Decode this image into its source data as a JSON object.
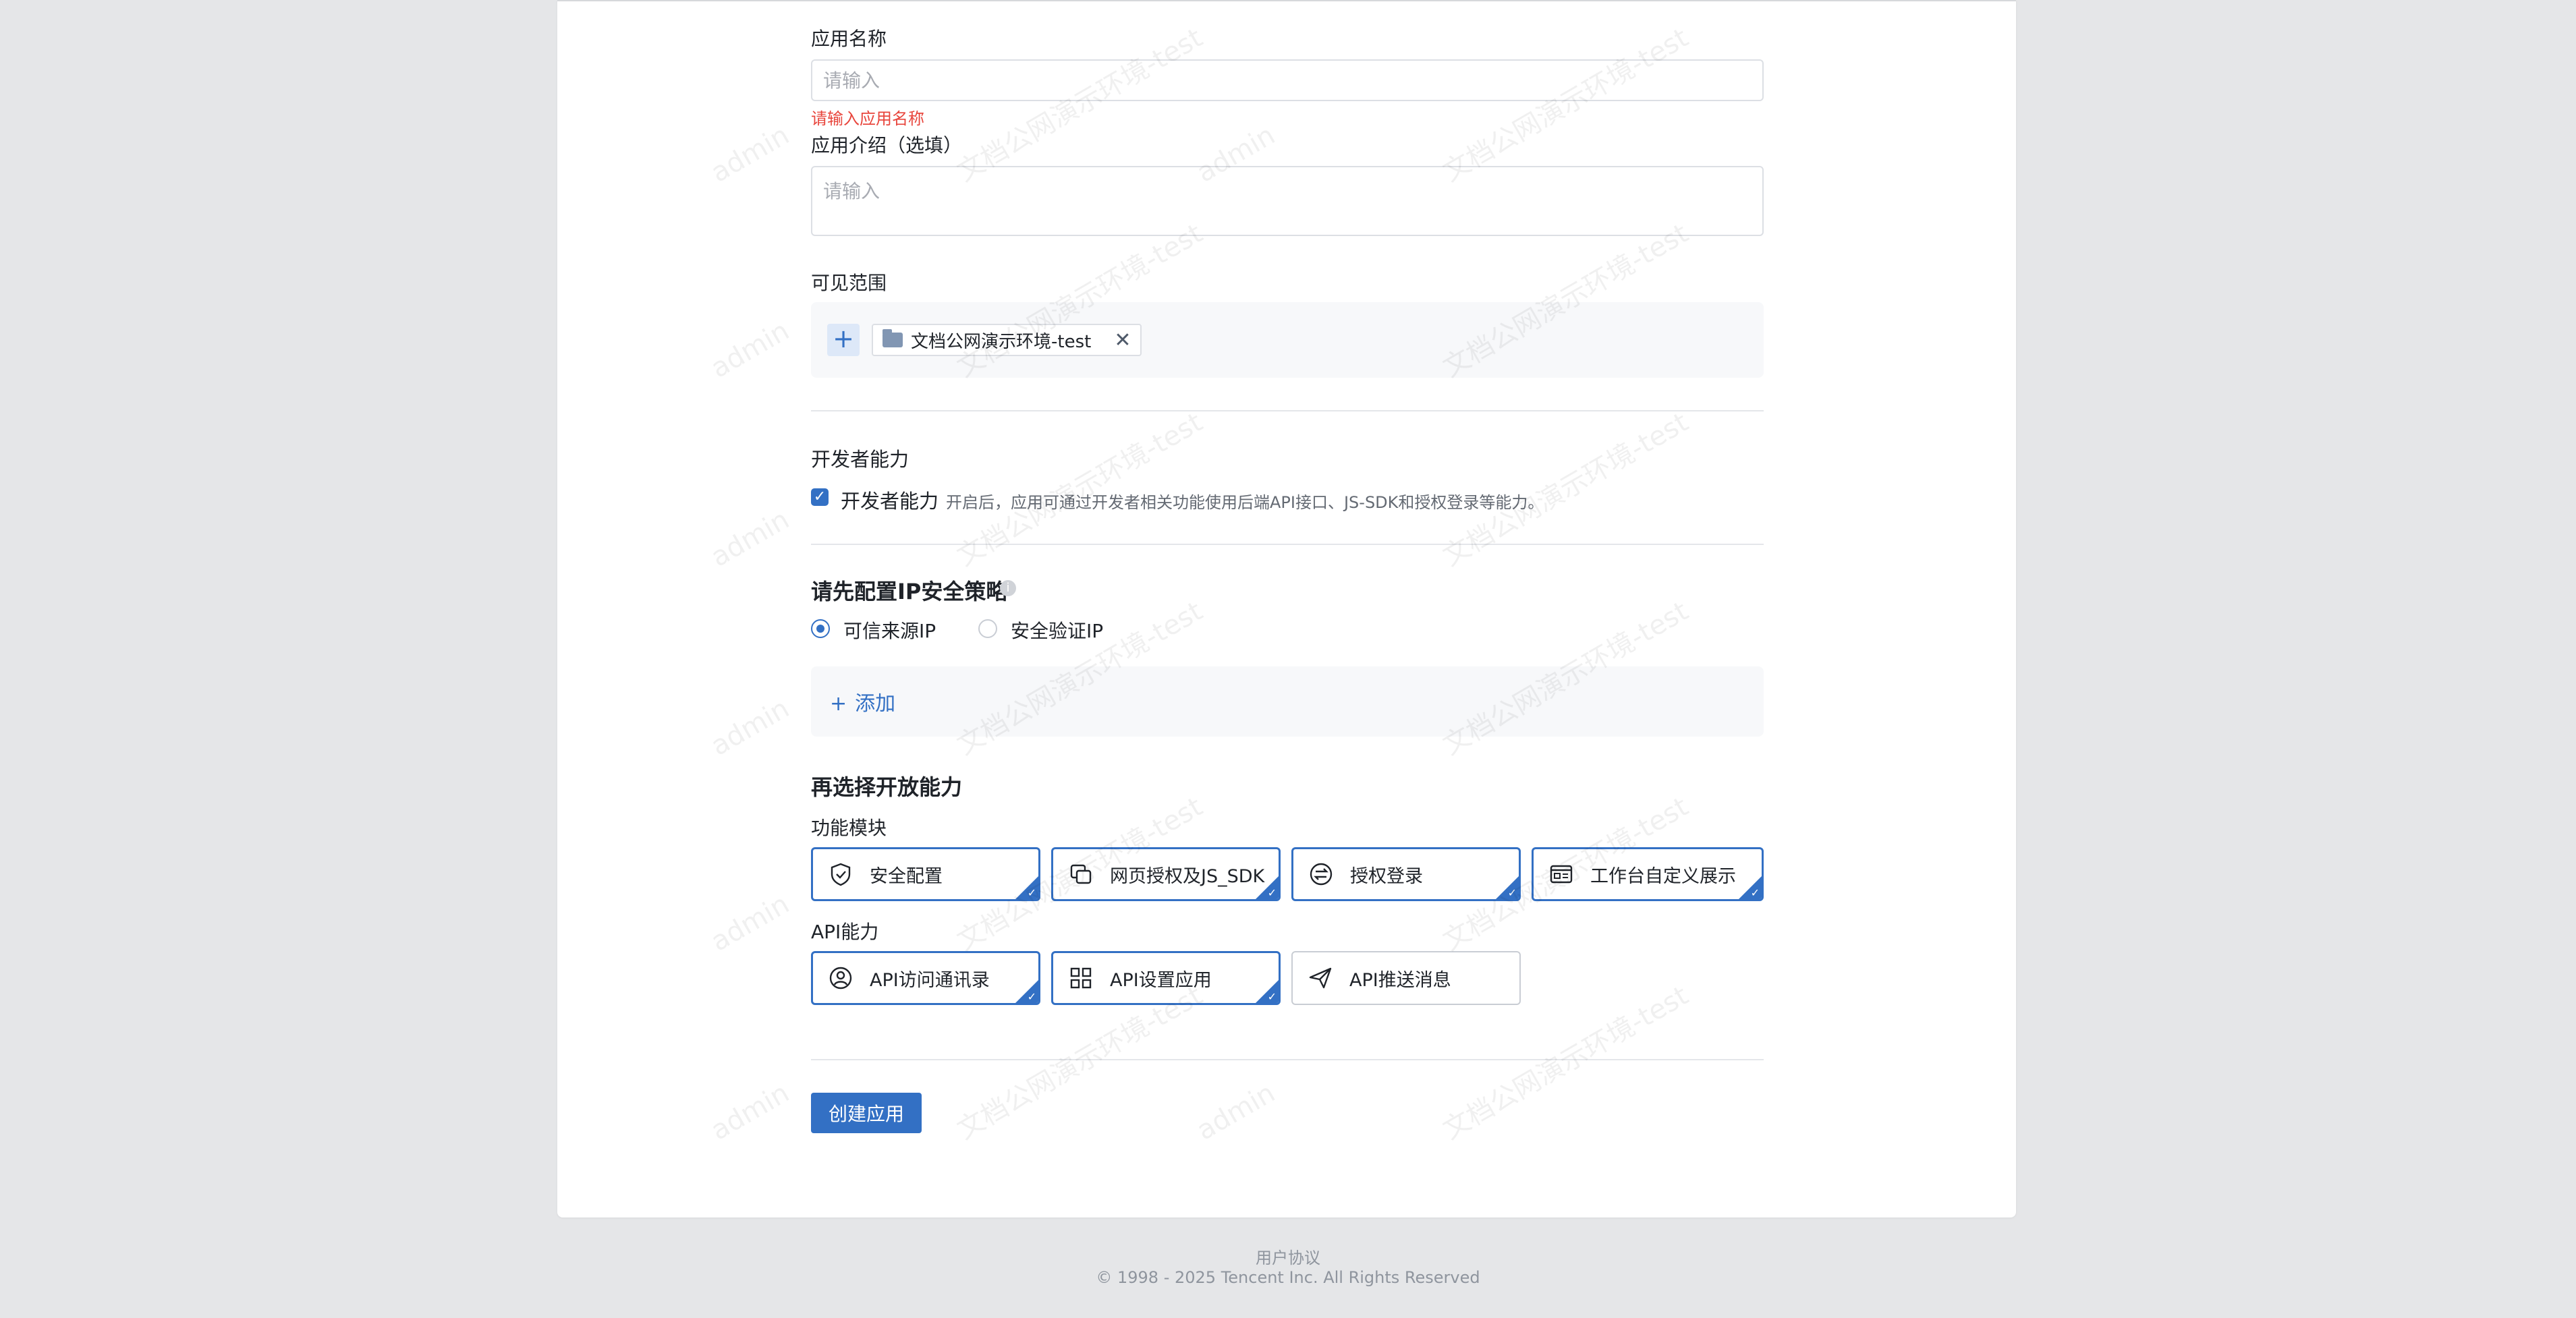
{
  "form": {
    "app_name_label": "应用名称",
    "app_name_placeholder": "请输入",
    "app_name_value": "",
    "app_name_error": "请输入应用名称",
    "app_intro_label": "应用介绍（选填）",
    "app_intro_placeholder": "请输入",
    "app_intro_value": "",
    "visibility_label": "可见范围",
    "visibility_tags": [
      {
        "label": "文档公网演示环境-test",
        "icon": "folder-icon"
      }
    ]
  },
  "developer": {
    "title": "开发者能力",
    "checkbox_label": "开发者能力",
    "checked": true,
    "hint": "开启后，应用可通过开发者相关功能使用后端API接口、JS-SDK和授权登录等能力。"
  },
  "ip_policy": {
    "title": "请先配置IP安全策略",
    "options": [
      {
        "label": "可信来源IP",
        "selected": true
      },
      {
        "label": "安全验证IP",
        "selected": false
      }
    ],
    "add_label": "添加"
  },
  "capabilities": {
    "title": "再选择开放能力",
    "modules_label": "功能模块",
    "modules": [
      {
        "label": "安全配置",
        "icon": "shield-icon",
        "selected": true
      },
      {
        "label": "网页授权及JS_SDK",
        "icon": "web-auth-icon",
        "selected": true
      },
      {
        "label": "授权登录",
        "icon": "swap-icon",
        "selected": true
      },
      {
        "label": "工作台自定义展示",
        "icon": "workbench-icon",
        "selected": true
      }
    ],
    "api_label": "API能力",
    "apis": [
      {
        "label": "API访问通讯录",
        "icon": "contact-icon",
        "selected": true
      },
      {
        "label": "API设置应用",
        "icon": "grid-icon",
        "selected": true
      },
      {
        "label": "API推送消息",
        "icon": "send-icon",
        "selected": false
      }
    ]
  },
  "submit_label": "创建应用",
  "footer": {
    "agreement": "用户协议",
    "copyright": "© 1998 - 2025 Tencent Inc. All Rights Reserved"
  },
  "watermark": {
    "text_a": "admin",
    "text_b": "文档公网演示环境-test"
  },
  "colors": {
    "accent": "#3370c4",
    "error": "#e8453c",
    "page_bg": "#e5e6e8"
  }
}
